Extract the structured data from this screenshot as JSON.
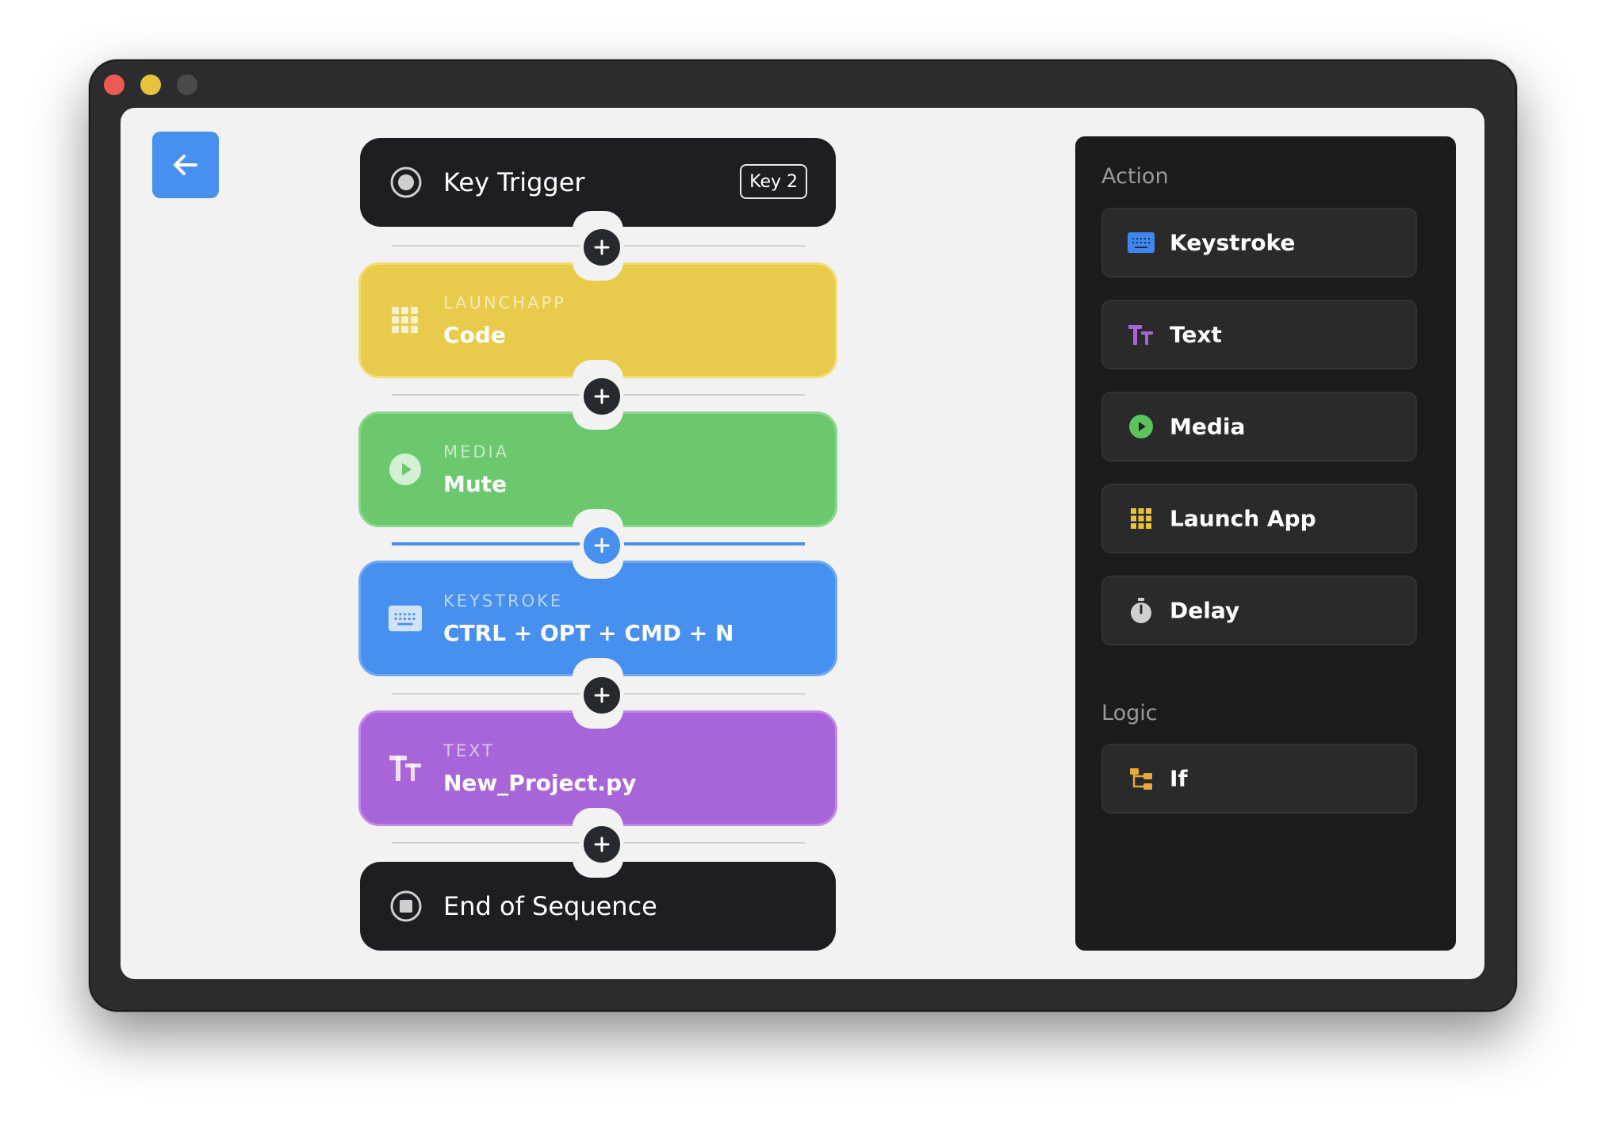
{
  "window": {
    "controls": [
      "close",
      "minimize",
      "maximize"
    ]
  },
  "back_button": {
    "icon": "arrow-left-icon"
  },
  "sequence": {
    "trigger": {
      "title": "Key Trigger",
      "badge": "Key 2",
      "icon": "record-icon"
    },
    "steps": [
      {
        "kind": "LAUNCHAPP",
        "value": "Code",
        "color": "#e8cb4a",
        "icon": "app-grid-icon"
      },
      {
        "kind": "MEDIA",
        "value": "Mute",
        "color": "#6cc86e",
        "icon": "play-icon"
      },
      {
        "kind": "KEYSTROKE",
        "value": "CTRL + OPT + CMD + N",
        "color": "#4790f0",
        "icon": "keyboard-icon",
        "selected": true
      },
      {
        "kind": "TEXT",
        "value": "New_Project.py",
        "color": "#a865d9",
        "icon": "text-size-icon"
      }
    ],
    "end": {
      "title": "End of Sequence",
      "icon": "stop-icon"
    }
  },
  "panel": {
    "action_label": "Action",
    "actions": [
      {
        "label": "Keystroke",
        "icon": "keyboard-icon",
        "color": "#3f86ee"
      },
      {
        "label": "Text",
        "icon": "text-size-icon",
        "color": "#a865d9"
      },
      {
        "label": "Media",
        "icon": "play-icon",
        "color": "#5cc25e"
      },
      {
        "label": "Launch App",
        "icon": "app-grid-icon",
        "color": "#e8c23d"
      },
      {
        "label": "Delay",
        "icon": "stopwatch-icon",
        "color": "#cfcfcf"
      }
    ],
    "logic_label": "Logic",
    "logic": [
      {
        "label": "If",
        "icon": "branch-icon",
        "color": "#e8a93d"
      }
    ]
  }
}
